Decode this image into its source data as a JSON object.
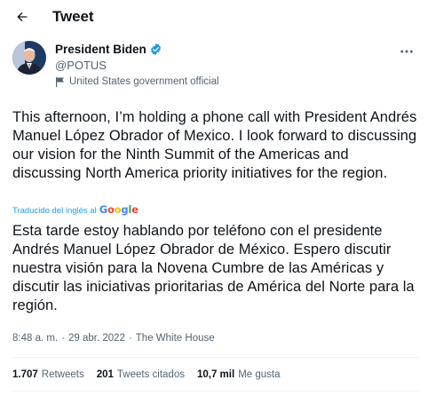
{
  "header": {
    "title": "Tweet",
    "back_icon": "arrow-left-icon"
  },
  "author": {
    "name": "President Biden",
    "handle": "@POTUS",
    "verified": true,
    "gov_label": "United States government official",
    "gov_icon": "flag-icon"
  },
  "tweet": {
    "text": "This afternoon, I’m holding a phone call with President Andrés Manuel López Obrador of Mexico. I look forward to discussing our vision for the Ninth Summit of the Americas and discussing North America priority initiatives for the region.",
    "translated_by": "Traducido del inglés al",
    "translator": "Google",
    "translation": "Esta tarde estoy hablando por teléfono con el presidente Andrés Manuel López Obrador de México. Espero discutir nuestra visión para la Novena Cumbre de las Américas y discutir las iniciativas prioritarias de América del Norte para la región.",
    "time": "8:48 a. m.",
    "date": "29 abr. 2022",
    "source": "The White House"
  },
  "stats": {
    "retweets_value": "1.707",
    "retweets_label": "Retweets",
    "quotes_value": "201",
    "quotes_label": "Tweets citados",
    "likes_value": "10,7 mil",
    "likes_label": "Me gusta"
  },
  "colors": {
    "accent": "#1d9bf0",
    "text": "#0f1419",
    "secondary": "#536471",
    "google_blue": "#4285f4",
    "google_red": "#ea4335",
    "google_yellow": "#fbbc05",
    "google_green": "#34a853"
  }
}
